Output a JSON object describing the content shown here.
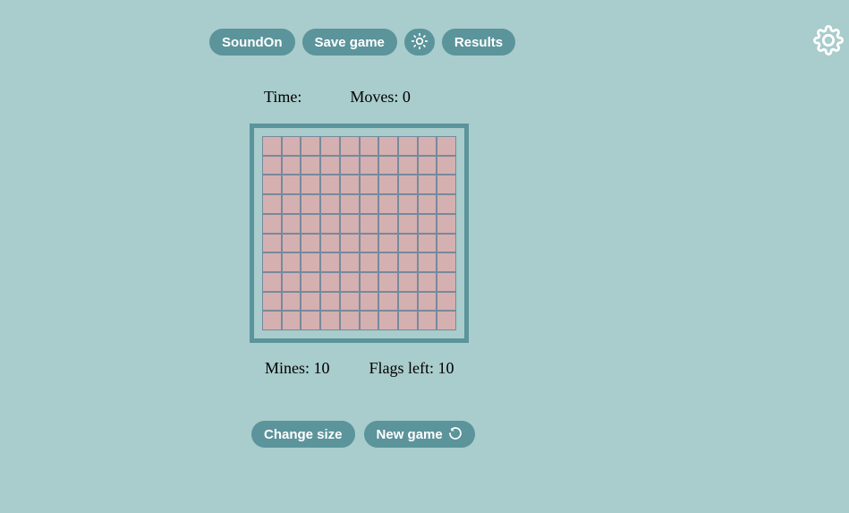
{
  "toolbar": {
    "sound_label": "SoundOn",
    "save_label": "Save game",
    "results_label": "Results"
  },
  "stats": {
    "time_label": "Time:",
    "time_value": "",
    "moves_label": "Moves:",
    "moves_value": "0",
    "mines_label": "Mines:",
    "mines_value": "10",
    "flags_label": "Flags left:",
    "flags_value": "10"
  },
  "board": {
    "rows": 10,
    "cols": 10
  },
  "actions": {
    "change_size_label": "Change size",
    "new_game_label": "New game"
  },
  "colors": {
    "bg": "#a9cccc",
    "button": "#5b949b",
    "cell": "#d4b0b0",
    "cell_gap": "#78899d"
  }
}
